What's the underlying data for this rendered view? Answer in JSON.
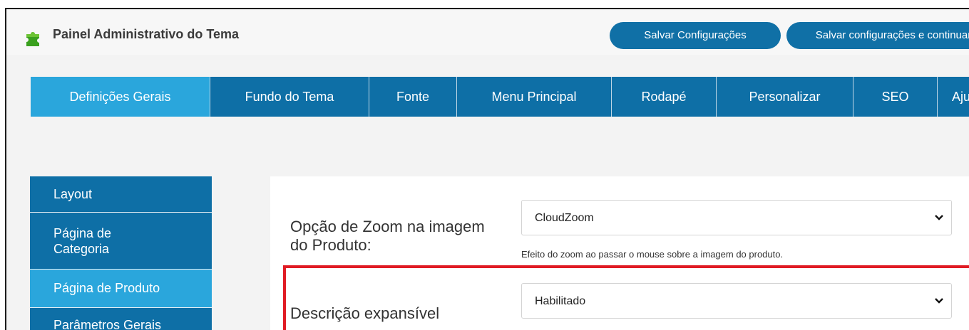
{
  "header": {
    "title": "Painel Administrativo do Tema",
    "save_label": "Salvar Configurações",
    "save_continue_label": "Salvar configurações e continuar"
  },
  "tabs": [
    {
      "label": "Definições Gerais",
      "active": true
    },
    {
      "label": "Fundo do Tema"
    },
    {
      "label": "Fonte"
    },
    {
      "label": "Menu Principal"
    },
    {
      "label": "Rodapé"
    },
    {
      "label": "Personalizar"
    },
    {
      "label": "SEO"
    },
    {
      "label": "Ajuda"
    }
  ],
  "sidebar": {
    "items": [
      {
        "label": "Layout"
      },
      {
        "label": "Página de Categoria"
      },
      {
        "label": "Página de Produto",
        "active": true
      },
      {
        "label": "Parâmetros Gerais"
      }
    ]
  },
  "form": {
    "zoom": {
      "label": "Opção de Zoom na imagem do Produto:",
      "value": "CloudZoom",
      "help": "Efeito do zoom ao passar o mouse sobre a imagem do produto."
    },
    "expand": {
      "label": "Descrição expansível",
      "value": "Habilitado"
    }
  },
  "colors": {
    "primary": "#0e6fa6",
    "active": "#2aa6dc",
    "highlight": "#e01b24"
  },
  "icons": {
    "logo": "puzzle-piece-icon",
    "dropdown": "chevron-down-icon"
  }
}
